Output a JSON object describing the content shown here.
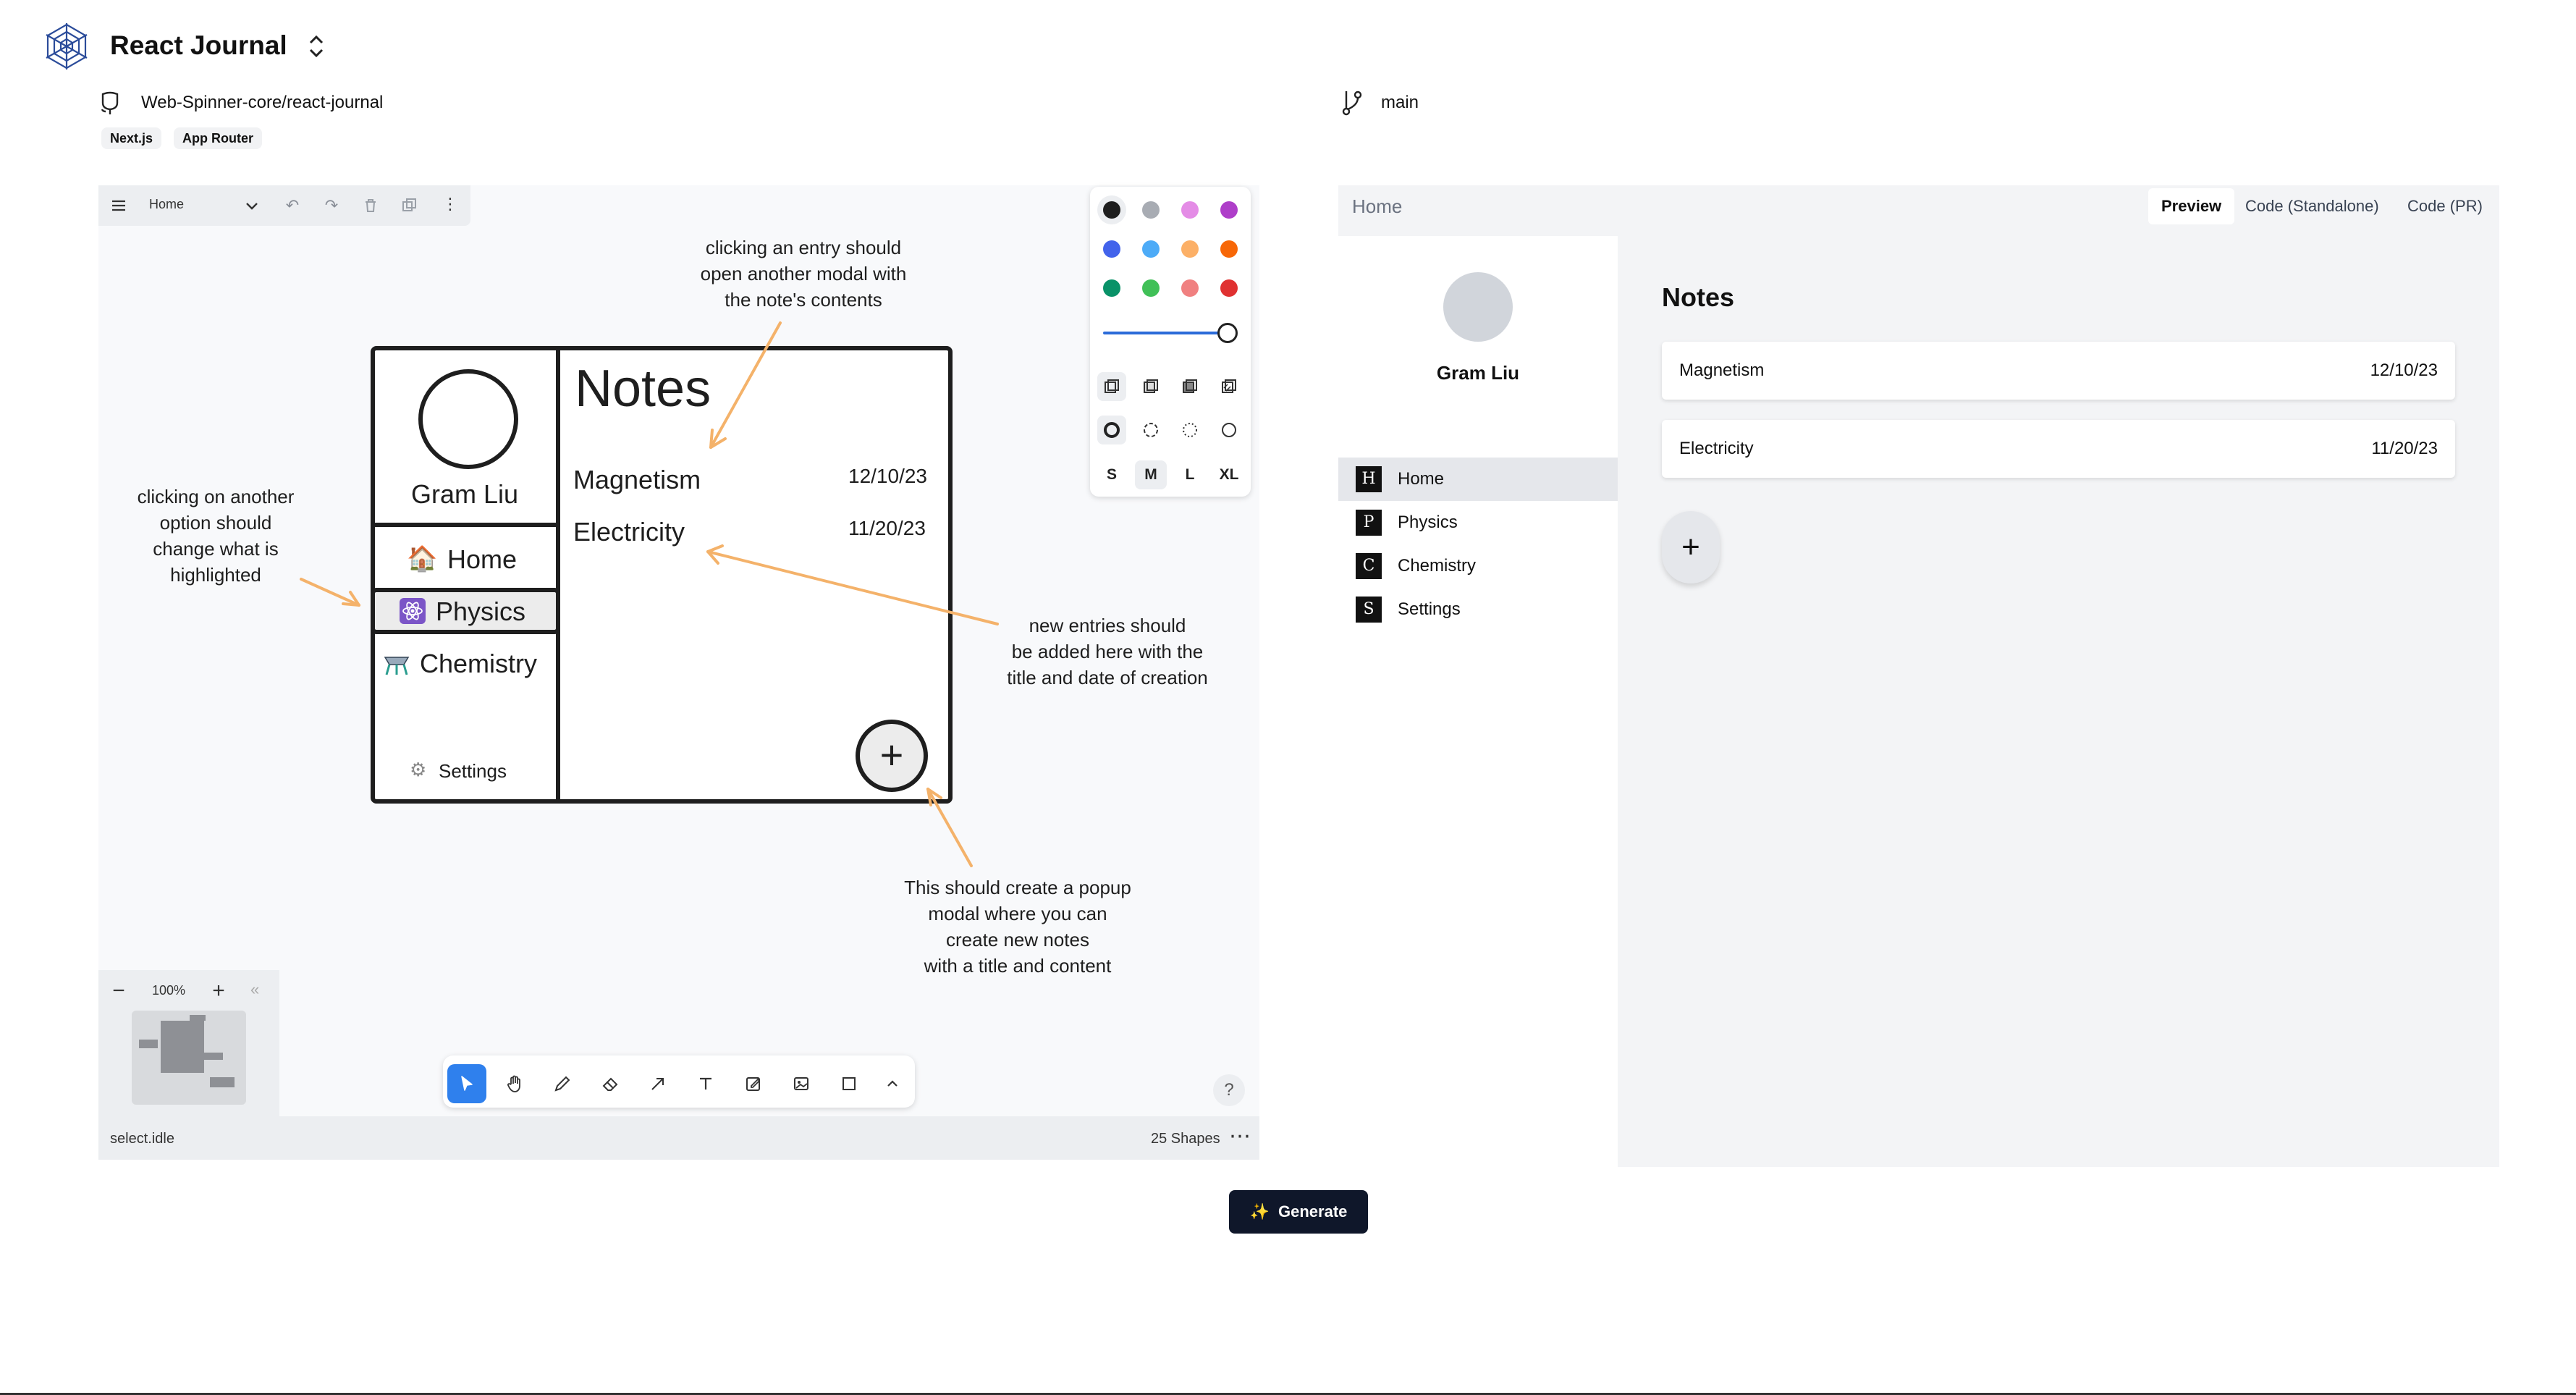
{
  "header": {
    "app_title": "React Journal",
    "repo": "Web-Spinner-core/react-journal",
    "branch": "main",
    "tags": [
      "Next.js",
      "App Router"
    ]
  },
  "canvas": {
    "page_name": "Home",
    "zoom": "100%",
    "status": "select.idle",
    "shape_count": "25 Shapes",
    "size_options": [
      "S",
      "M",
      "L",
      "XL"
    ],
    "active_size": "M",
    "palette": [
      "#1e1e1e",
      "#a8acb3",
      "#e48ce6",
      "#ae3ec9",
      "#4263eb",
      "#4dabf7",
      "#fcb067",
      "#f76707",
      "#099268",
      "#40c057",
      "#f08080",
      "#e03131"
    ],
    "sketch": {
      "profile_name": "Gram Liu",
      "nav": [
        "Home",
        "Physics",
        "Chemistry",
        "Settings"
      ],
      "title": "Notes",
      "entries": [
        {
          "title": "Magnetism",
          "date": "12/10/23"
        },
        {
          "title": "Electricity",
          "date": "11/20/23"
        }
      ],
      "add_symbol": "+"
    },
    "annotations": {
      "entry_click": [
        "clicking an entry should",
        "open another modal with",
        "the note's contents"
      ],
      "nav_click": [
        "clicking on another",
        "option should",
        "change what is",
        "highlighted"
      ],
      "new_entries": [
        "new entries should",
        "be added here with the",
        "title and date of creation"
      ],
      "popup": [
        "This should create a popup",
        "modal where you can",
        "create new notes",
        "with a title and content"
      ]
    }
  },
  "generate_label": "Generate",
  "preview": {
    "path": "Home",
    "tabs": [
      "Preview",
      "Code (Standalone)",
      "Code (PR)"
    ],
    "active_tab": "Preview",
    "profile_name": "Gram Liu",
    "nav": [
      {
        "icon": "H",
        "label": "Home"
      },
      {
        "icon": "P",
        "label": "Physics"
      },
      {
        "icon": "C",
        "label": "Chemistry"
      },
      {
        "icon": "S",
        "label": "Settings"
      }
    ],
    "notes_title": "Notes",
    "notes": [
      {
        "title": "Magnetism",
        "date": "12/10/23"
      },
      {
        "title": "Electricity",
        "date": "11/20/23"
      }
    ],
    "add_symbol": "+"
  }
}
